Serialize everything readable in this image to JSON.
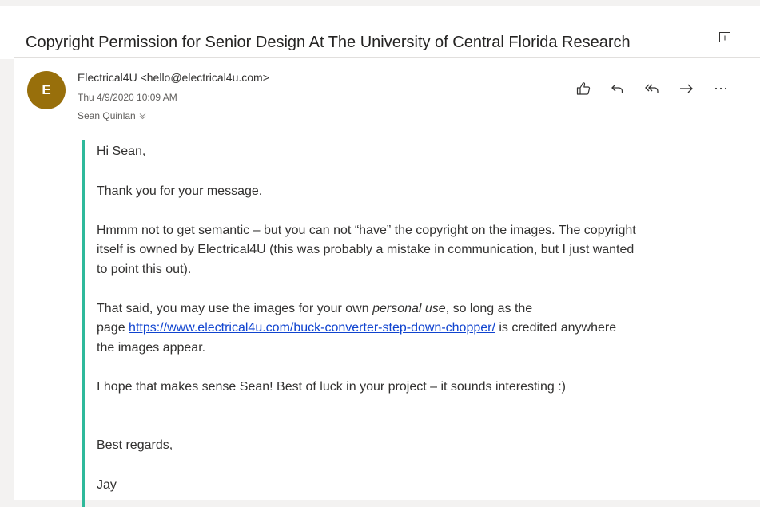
{
  "subject": "Copyright Permission for Senior Design At The University of Central Florida Research",
  "message": {
    "avatar_initial": "E",
    "avatar_color": "#986f0b",
    "sender": "Electrical4U <hello@electrical4u.com>",
    "date": "Thu 4/9/2020 10:09 AM",
    "recipient": "Sean Quinlan",
    "actions": [
      {
        "name": "like",
        "icon": "thumbs-up-icon"
      },
      {
        "name": "reply",
        "icon": "reply-icon"
      },
      {
        "name": "reply-all",
        "icon": "reply-all-icon"
      },
      {
        "name": "forward",
        "icon": "forward-icon"
      },
      {
        "name": "more",
        "icon": "more-icon"
      }
    ],
    "body": {
      "greeting": "Hi Sean,",
      "thanks": "Thank you for your message.",
      "p3_line1": "Hmmm not to get semantic – but you can not “have” the copyright on the images. The copyright",
      "p3_line2": "itself is owned by Electrical4U (this was probably a mistake in communication, but I just wanted",
      "p3_line3": "to point this out).",
      "p4_line1_before": "That said, you may use the images for your own ",
      "p4_line1_em": "personal use",
      "p4_line1_after": ", so long as the",
      "p4_line2_before": "page ",
      "p4_link": "https://www.electrical4u.com/buck-converter-step-down-chopper/",
      "p4_line2_after": " is credited anywhere",
      "p4_line3": "the images appear.",
      "p5": "I hope that makes sense Sean! Best of luck in your project – it sounds interesting :)",
      "closing": "Best regards,",
      "signature": "Jay"
    },
    "accent_color": "#2fb99b",
    "link_color": "#0f43cf"
  }
}
